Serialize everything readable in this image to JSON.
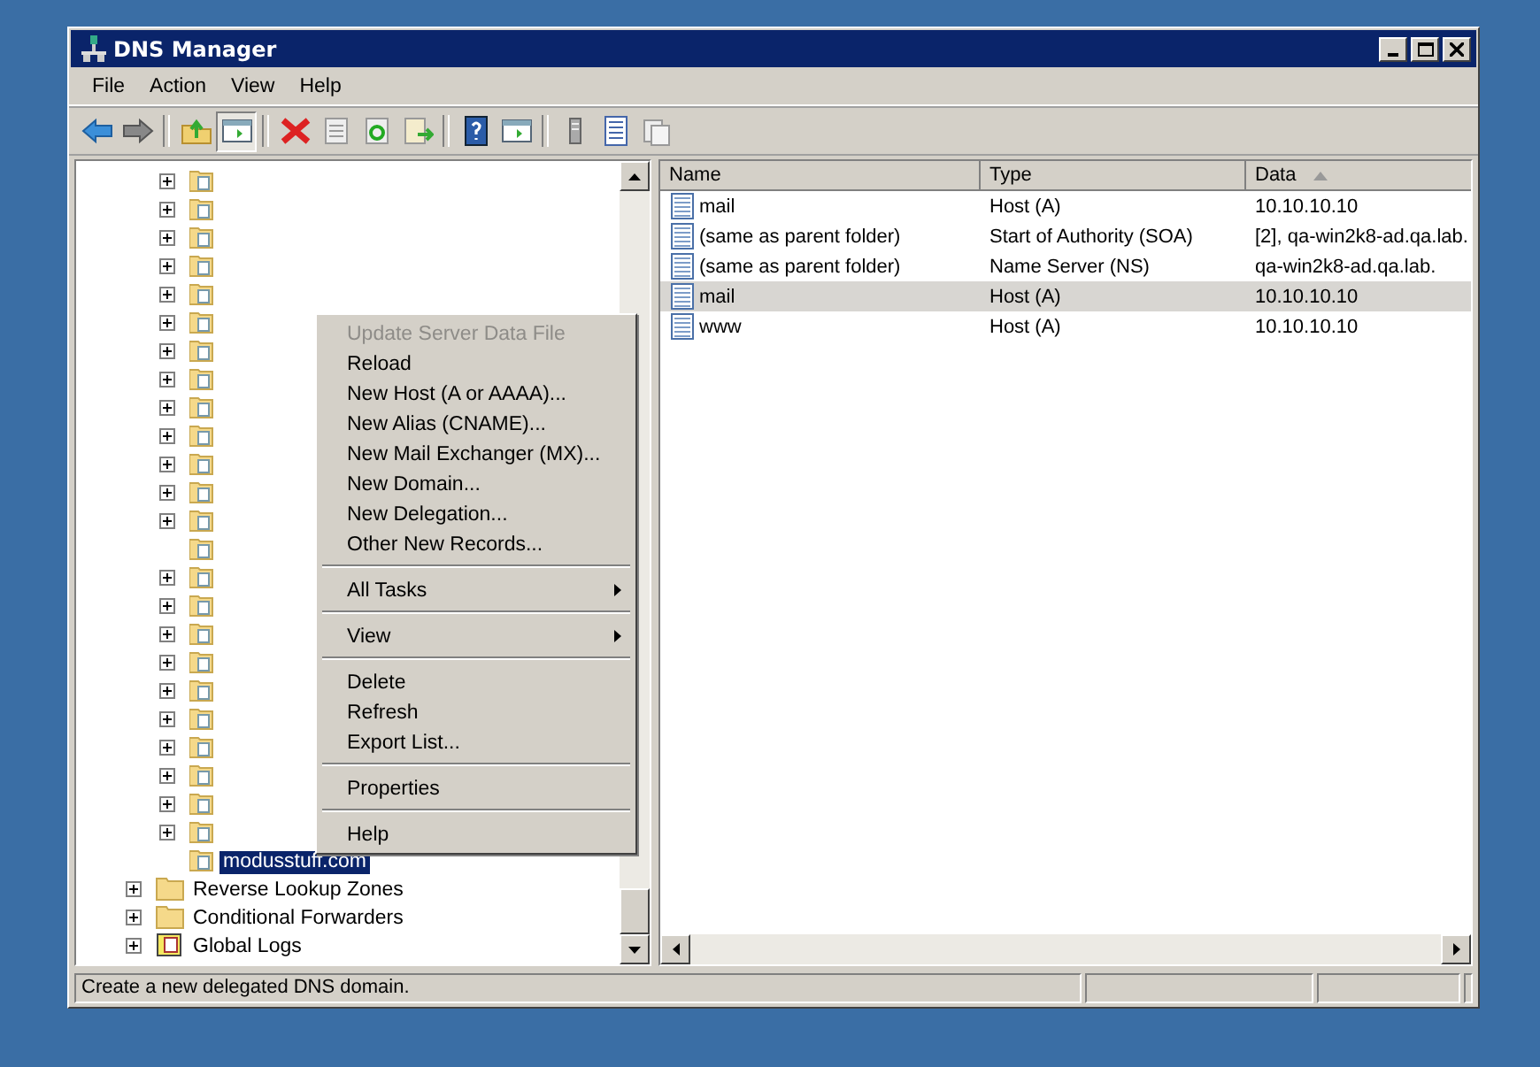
{
  "window": {
    "title": "DNS Manager"
  },
  "menu": [
    "File",
    "Action",
    "View",
    "Help"
  ],
  "tree": {
    "zones": [
      {
        "expandable": true
      },
      {
        "expandable": true
      },
      {
        "expandable": true
      },
      {
        "expandable": true
      },
      {
        "expandable": true
      },
      {
        "expandable": true
      },
      {
        "expandable": true
      },
      {
        "expandable": true
      },
      {
        "expandable": true
      },
      {
        "expandable": true
      },
      {
        "expandable": true
      },
      {
        "expandable": true
      },
      {
        "expandable": true
      },
      {
        "expandable": false
      },
      {
        "expandable": true
      },
      {
        "expandable": true
      },
      {
        "expandable": true
      },
      {
        "expandable": true
      },
      {
        "expandable": true
      },
      {
        "expandable": true
      },
      {
        "expandable": true
      },
      {
        "expandable": true
      },
      {
        "expandable": true
      },
      {
        "expandable": true
      },
      {
        "expandable": false,
        "label": "modusstuff.com",
        "selected": true
      }
    ],
    "items": [
      {
        "kind": "folder",
        "label": "Reverse Lookup Zones",
        "selected": false
      },
      {
        "kind": "folder",
        "label": "Conditional Forwarders",
        "selected": false
      },
      {
        "kind": "logs",
        "label": "Global Logs",
        "selected": false
      }
    ]
  },
  "context_menu": [
    {
      "kind": "item",
      "label": "Update Server Data File",
      "disabled": true
    },
    {
      "kind": "item",
      "label": "Reload",
      "disabled": false
    },
    {
      "kind": "item",
      "label": "New Host (A or AAAA)...",
      "disabled": false
    },
    {
      "kind": "item",
      "label": "New Alias (CNAME)...",
      "disabled": false
    },
    {
      "kind": "item",
      "label": "New Mail Exchanger (MX)...",
      "disabled": false
    },
    {
      "kind": "item",
      "label": "New Domain...",
      "disabled": false
    },
    {
      "kind": "item",
      "label": "New Delegation...",
      "disabled": false
    },
    {
      "kind": "item",
      "label": "Other New Records...",
      "disabled": false
    },
    {
      "kind": "separator"
    },
    {
      "kind": "submenu",
      "label": "All Tasks",
      "disabled": false
    },
    {
      "kind": "separator"
    },
    {
      "kind": "submenu",
      "label": "View",
      "disabled": false
    },
    {
      "kind": "separator"
    },
    {
      "kind": "item",
      "label": "Delete",
      "disabled": false
    },
    {
      "kind": "item",
      "label": "Refresh",
      "disabled": false
    },
    {
      "kind": "item",
      "label": "Export List...",
      "disabled": false
    },
    {
      "kind": "separator"
    },
    {
      "kind": "item",
      "label": "Properties",
      "disabled": false
    },
    {
      "kind": "separator"
    },
    {
      "kind": "item",
      "label": "Help",
      "disabled": false
    }
  ],
  "table": {
    "columns": [
      {
        "label": "Name",
        "sorted": false
      },
      {
        "label": "Type",
        "sorted": false
      },
      {
        "label": "Data",
        "sorted": true
      }
    ],
    "rows": [
      {
        "name": "mail",
        "type": "Host (A)",
        "data": "10.10.10.10",
        "selected": false
      },
      {
        "name": "(same as parent folder)",
        "type": "Start of Authority (SOA)",
        "data": "[2], qa-win2k8-ad.qa.lab.",
        "selected": false
      },
      {
        "name": "(same as parent folder)",
        "type": "Name Server (NS)",
        "data": "qa-win2k8-ad.qa.lab.",
        "selected": false
      },
      {
        "name": "mail",
        "type": "Host (A)",
        "data": "10.10.10.10",
        "selected": true
      },
      {
        "name": "www",
        "type": "Host (A)",
        "data": "10.10.10.10",
        "selected": false
      }
    ]
  },
  "status_bar": "Create a new delegated DNS domain."
}
